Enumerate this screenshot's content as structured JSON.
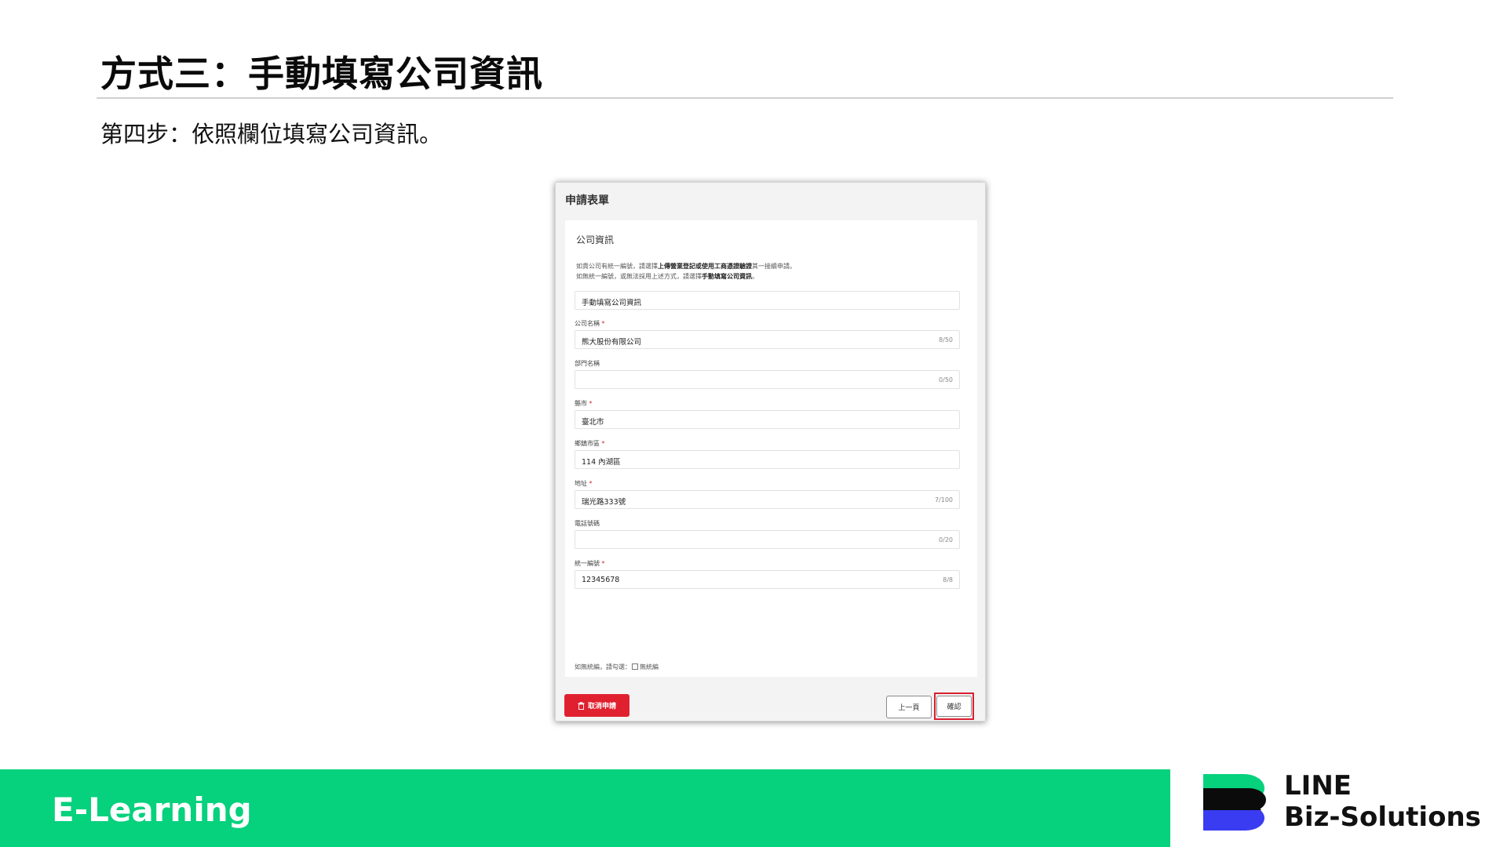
{
  "slide": {
    "title": "方式三：手動填寫公司資訊",
    "subtitle": "第四步：依照欄位填寫公司資訊。"
  },
  "form": {
    "header": "申請表單",
    "section_title": "公司資訊",
    "note_line1_a": "如貴公司有統一編號，請選擇",
    "note_line1_b": "上傳營業登記或使用工商憑證驗證",
    "note_line1_c": "其一接續申請。",
    "note_line2_a": "如無統一編號，或無法採用上述方式，請選擇",
    "note_line2_b": "手動填寫公司資訊",
    "note_line2_c": "。",
    "method_value": "手動填寫公司資訊",
    "required_mark": "*",
    "fields": [
      {
        "label": "公司名稱",
        "required": true,
        "value": "熊大股份有限公司",
        "counter": "8/50"
      },
      {
        "label": "部門名稱",
        "required": false,
        "value": "",
        "counter": "0/50"
      },
      {
        "label": "縣市",
        "required": true,
        "value": "臺北市",
        "counter": ""
      },
      {
        "label": "鄉鎮市區",
        "required": true,
        "value": "114 內湖區",
        "counter": ""
      },
      {
        "label": "地址",
        "required": true,
        "value": "瑞光路333號",
        "counter": "7/100"
      },
      {
        "label": "電話號碼",
        "required": false,
        "value": "",
        "counter": "0/20"
      },
      {
        "label": "統一編號",
        "required": true,
        "value": "12345678",
        "counter": "8/8"
      }
    ],
    "no_tax_id_prompt": "如無統編，請勾選：",
    "no_tax_id_checkbox_label": "無統編",
    "cancel_button": "取消申請",
    "prev_button": "上一頁",
    "confirm_button": "確認"
  },
  "footer": {
    "label": "E-Learning",
    "brand_line1": "LINE",
    "brand_line2": "Biz-Solutions"
  },
  "colors": {
    "footer_green": "#06d17d",
    "cancel_red": "#e0202f",
    "highlight_red": "#d92030",
    "logo_black": "#0b0b0b",
    "logo_green": "#06d17d",
    "logo_blue": "#3a3cf2"
  },
  "icons": {
    "cancel_button_icon": "trash-icon"
  }
}
